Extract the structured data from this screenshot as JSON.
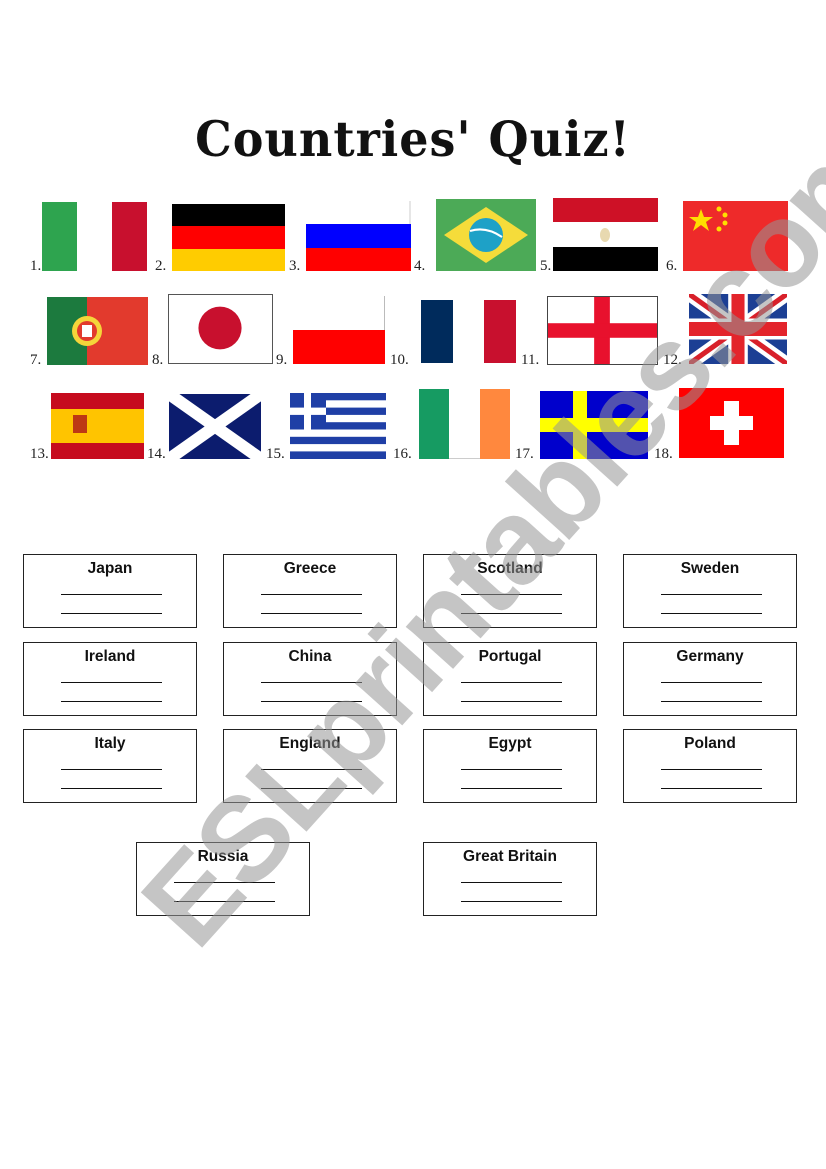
{
  "title": "Countries' Quiz!",
  "watermark": "ESLprintables.com",
  "flags": [
    {
      "number": "1.",
      "icon": "italy-flag-icon"
    },
    {
      "number": "2.",
      "icon": "germany-flag-icon"
    },
    {
      "number": "3.",
      "icon": "russia-flag-icon"
    },
    {
      "number": "4.",
      "icon": "brazil-flag-icon"
    },
    {
      "number": "5.",
      "icon": "egypt-flag-icon"
    },
    {
      "number": "6.",
      "icon": "china-flag-icon"
    },
    {
      "number": "7.",
      "icon": "portugal-flag-icon"
    },
    {
      "number": "8.",
      "icon": "japan-flag-icon"
    },
    {
      "number": "9.",
      "icon": "poland-flag-icon"
    },
    {
      "number": "10.",
      "icon": "france-flag-icon"
    },
    {
      "number": "11.",
      "icon": "england-flag-icon"
    },
    {
      "number": "12.",
      "icon": "uk-flag-icon"
    },
    {
      "number": "13.",
      "icon": "spain-flag-icon"
    },
    {
      "number": "14.",
      "icon": "scotland-flag-icon"
    },
    {
      "number": "15.",
      "icon": "greece-flag-icon"
    },
    {
      "number": "16.",
      "icon": "ireland-flag-icon"
    },
    {
      "number": "17.",
      "icon": "sweden-flag-icon"
    },
    {
      "number": "18.",
      "icon": "switzerland-flag-icon"
    }
  ],
  "answer_boxes": [
    {
      "country": "Japan"
    },
    {
      "country": "Greece"
    },
    {
      "country": "Scotland"
    },
    {
      "country": "Sweden"
    },
    {
      "country": "Ireland"
    },
    {
      "country": "China"
    },
    {
      "country": "Portugal"
    },
    {
      "country": "Germany"
    },
    {
      "country": "Italy"
    },
    {
      "country": "England"
    },
    {
      "country": "Egypt"
    },
    {
      "country": "Poland"
    },
    {
      "country": "Russia"
    },
    {
      "country": "Great Britain"
    }
  ]
}
